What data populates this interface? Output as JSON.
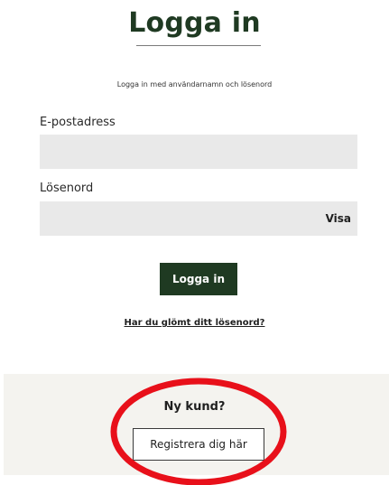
{
  "login": {
    "title": "Logga in",
    "subtitle": "Logga in med användarnamn och lösenord",
    "email_label": "E-postadress",
    "email_value": "",
    "password_label": "Lösenord",
    "password_value": "",
    "show_password_label": "Visa",
    "submit_label": "Logga in",
    "forgot_password_link": "Har du glömt ditt lösenord?"
  },
  "new_customer": {
    "heading": "Ny kund?",
    "register_label": "Registrera dig här"
  },
  "colors": {
    "brand_green": "#1f3a22",
    "input_bg": "#e9e9e9",
    "section_bg": "#f4f3ef",
    "annotation_red": "#e8101a"
  }
}
